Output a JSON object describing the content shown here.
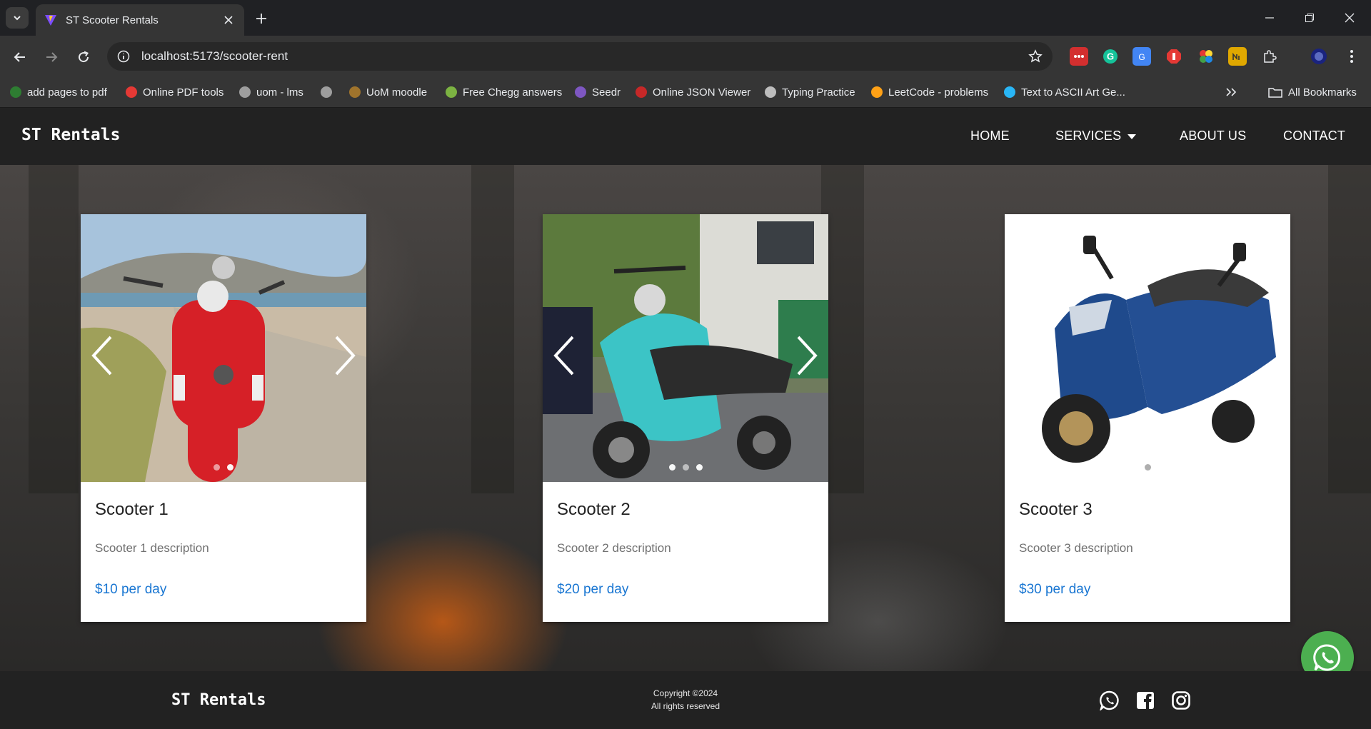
{
  "browser": {
    "tab_title": "ST Scooter Rentals",
    "url": "localhost:5173/scooter-rent",
    "bookmarks": [
      {
        "label": "add pages to pdf",
        "color": "#2e7d32"
      },
      {
        "label": "Online PDF tools",
        "color": "#e53935"
      },
      {
        "label": "uom - lms",
        "color": "#9e9e9e"
      },
      {
        "label": "",
        "color": "#9e9e9e"
      },
      {
        "label": "UoM moodle",
        "color": "#a0742c"
      },
      {
        "label": "Free Chegg answers",
        "color": "#7cb342"
      },
      {
        "label": "Seedr",
        "color": "#7e57c2"
      },
      {
        "label": "Online JSON Viewer",
        "color": "#c62828"
      },
      {
        "label": "Typing Practice",
        "color": "#bdbdbd"
      },
      {
        "label": "LeetCode - problems",
        "color": "#ffa116"
      },
      {
        "label": "Text to ASCII Art Ge...",
        "color": "#29b6f6"
      }
    ],
    "all_bookmarks": "All Bookmarks"
  },
  "site": {
    "brand": "ST Rentals",
    "nav": {
      "home": "HOME",
      "services": "SERVICES",
      "about": "ABOUT US",
      "contact": "CONTACT"
    }
  },
  "cards": [
    {
      "name": "Scooter 1",
      "description": "Scooter 1 description",
      "price": "$10 per day",
      "scooter_color": "red"
    },
    {
      "name": "Scooter 2",
      "description": "Scooter 2 description",
      "price": "$20 per day",
      "scooter_color": "turquoise"
    },
    {
      "name": "Scooter 3",
      "description": "Scooter 3 description",
      "price": "$30 per day",
      "scooter_color": "blue"
    }
  ],
  "footer": {
    "brand": "ST Rentals",
    "copyright": "Copyright ©2024",
    "rights": "All rights reserved"
  },
  "colors": {
    "accent_price": "#1976d2",
    "whatsapp_fab": "#4caf50",
    "nav_bg": "#222222"
  }
}
